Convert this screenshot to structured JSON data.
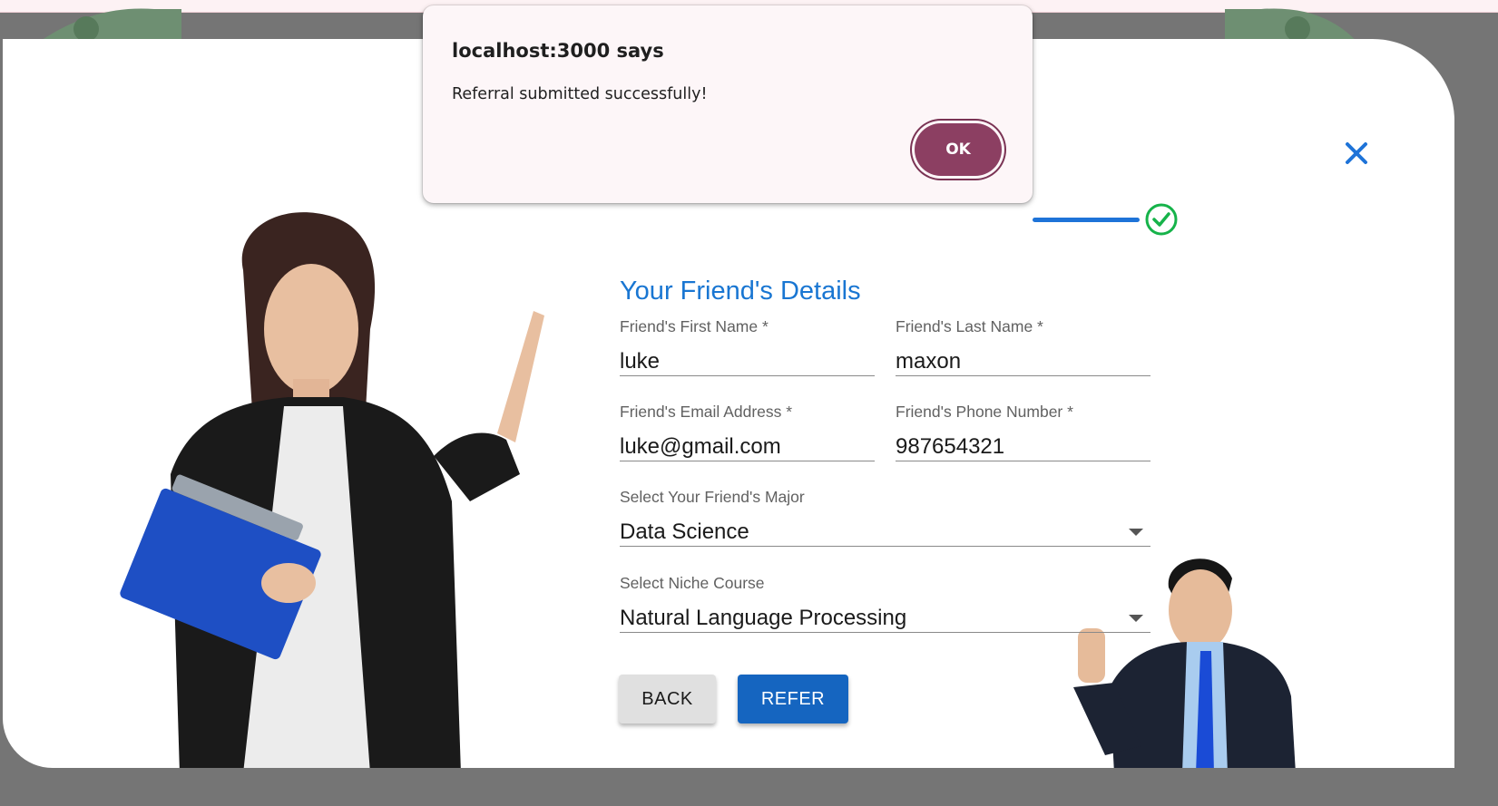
{
  "dialog": {
    "title": "localhost:3000 says",
    "message": "Referral submitted successfully!",
    "ok_label": "OK",
    "ok_color": "#8c3f62"
  },
  "form": {
    "title": "Your Friend's Details",
    "title_color": "#1976d2",
    "first_name": {
      "label": "Friend's First Name *",
      "value": "luke"
    },
    "last_name": {
      "label": "Friend's Last Name *",
      "value": "maxon"
    },
    "email": {
      "label": "Friend's Email Address *",
      "value": "luke@gmail.com"
    },
    "phone": {
      "label": "Friend's Phone Number *",
      "value": "987654321"
    },
    "major": {
      "label": "Select Your Friend's Major",
      "value": "Data Science"
    },
    "niche_course": {
      "label": "Select Niche Course",
      "value": "Natural Language Processing"
    },
    "back_label": "BACK",
    "refer_label": "REFER",
    "accent_color": "#1565c0"
  },
  "stepper": {
    "status": "completed",
    "check_color": "#16b34a"
  },
  "icons": {
    "close": "close-icon",
    "check": "check-circle-icon",
    "dropdown": "chevron-down-icon"
  }
}
